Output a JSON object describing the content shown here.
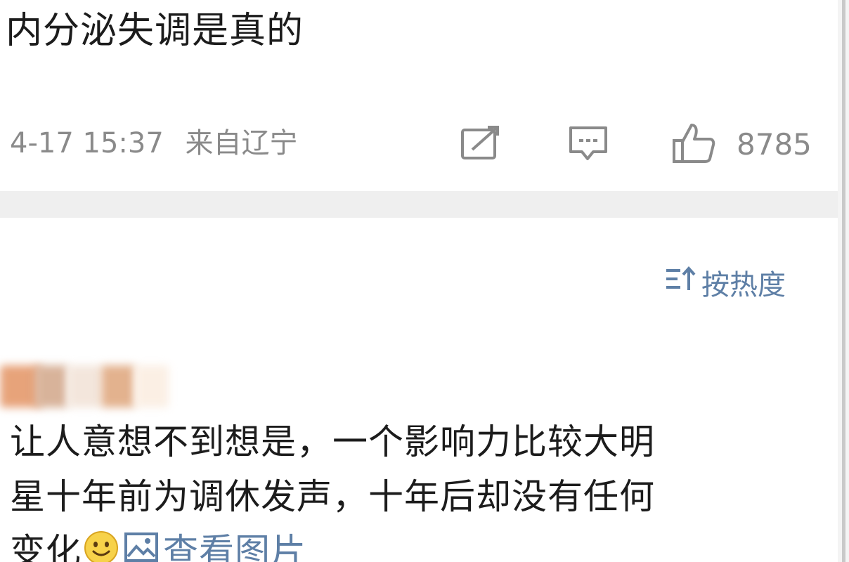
{
  "post": {
    "text": "内分泌失调是真的",
    "timestamp": "4-17 15:37",
    "source": "来自辽宁",
    "like_count": "8785",
    "icons": {
      "share": "share-icon",
      "comment": "comment-icon",
      "like": "thumbs-up-icon"
    }
  },
  "comments_header": {
    "sort_label": "按热度",
    "sort_icon": "sort-icon"
  },
  "comment": {
    "lines": [
      "让人意想不到想是，一个影响力比较大明",
      "星十年前为调休发声，十年后却没有任何",
      "变化"
    ],
    "emoji": "smile-emoji",
    "view_image_label": "查看图片",
    "view_image_icon": "image-icon"
  },
  "colors": {
    "text": "#1c1c1c",
    "meta": "#8a8a8a",
    "link": "#5e7fa6",
    "divider": "#efefef"
  }
}
